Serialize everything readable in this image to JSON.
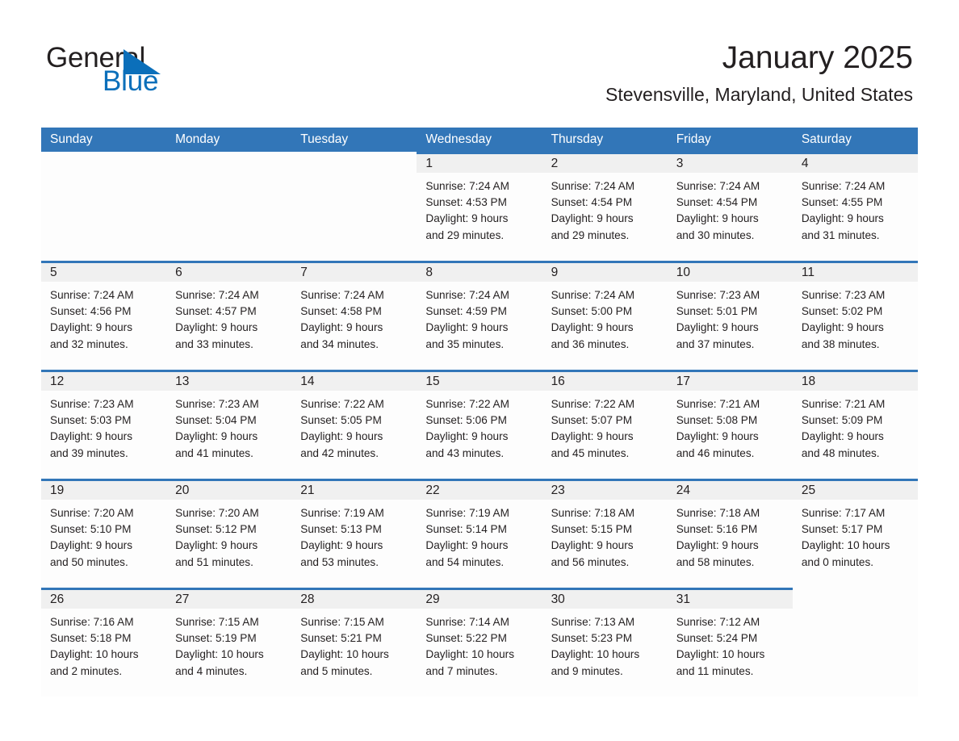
{
  "brand": {
    "name_part1": "General",
    "name_part2": "Blue",
    "accent_color": "#0b6fba",
    "logo_icon": "triangle-flag-icon"
  },
  "header": {
    "title": "January 2025",
    "subtitle": "Stevensville, Maryland, United States"
  },
  "theme": {
    "header_row_bg": "#3276b8",
    "day_band_bg": "#f0f0f0",
    "cell_bg": "#fdfdfd",
    "text_color": "#231f20"
  },
  "weekdays": [
    "Sunday",
    "Monday",
    "Tuesday",
    "Wednesday",
    "Thursday",
    "Friday",
    "Saturday"
  ],
  "weeks": [
    [
      {
        "blank": true
      },
      {
        "blank": true
      },
      {
        "blank": true
      },
      {
        "day": "1",
        "sunrise": "Sunrise: 7:24 AM",
        "sunset": "Sunset: 4:53 PM",
        "daylight_line1": "Daylight: 9 hours",
        "daylight_line2": "and 29 minutes."
      },
      {
        "day": "2",
        "sunrise": "Sunrise: 7:24 AM",
        "sunset": "Sunset: 4:54 PM",
        "daylight_line1": "Daylight: 9 hours",
        "daylight_line2": "and 29 minutes."
      },
      {
        "day": "3",
        "sunrise": "Sunrise: 7:24 AM",
        "sunset": "Sunset: 4:54 PM",
        "daylight_line1": "Daylight: 9 hours",
        "daylight_line2": "and 30 minutes."
      },
      {
        "day": "4",
        "sunrise": "Sunrise: 7:24 AM",
        "sunset": "Sunset: 4:55 PM",
        "daylight_line1": "Daylight: 9 hours",
        "daylight_line2": "and 31 minutes."
      }
    ],
    [
      {
        "day": "5",
        "sunrise": "Sunrise: 7:24 AM",
        "sunset": "Sunset: 4:56 PM",
        "daylight_line1": "Daylight: 9 hours",
        "daylight_line2": "and 32 minutes."
      },
      {
        "day": "6",
        "sunrise": "Sunrise: 7:24 AM",
        "sunset": "Sunset: 4:57 PM",
        "daylight_line1": "Daylight: 9 hours",
        "daylight_line2": "and 33 minutes."
      },
      {
        "day": "7",
        "sunrise": "Sunrise: 7:24 AM",
        "sunset": "Sunset: 4:58 PM",
        "daylight_line1": "Daylight: 9 hours",
        "daylight_line2": "and 34 minutes."
      },
      {
        "day": "8",
        "sunrise": "Sunrise: 7:24 AM",
        "sunset": "Sunset: 4:59 PM",
        "daylight_line1": "Daylight: 9 hours",
        "daylight_line2": "and 35 minutes."
      },
      {
        "day": "9",
        "sunrise": "Sunrise: 7:24 AM",
        "sunset": "Sunset: 5:00 PM",
        "daylight_line1": "Daylight: 9 hours",
        "daylight_line2": "and 36 minutes."
      },
      {
        "day": "10",
        "sunrise": "Sunrise: 7:23 AM",
        "sunset": "Sunset: 5:01 PM",
        "daylight_line1": "Daylight: 9 hours",
        "daylight_line2": "and 37 minutes."
      },
      {
        "day": "11",
        "sunrise": "Sunrise: 7:23 AM",
        "sunset": "Sunset: 5:02 PM",
        "daylight_line1": "Daylight: 9 hours",
        "daylight_line2": "and 38 minutes."
      }
    ],
    [
      {
        "day": "12",
        "sunrise": "Sunrise: 7:23 AM",
        "sunset": "Sunset: 5:03 PM",
        "daylight_line1": "Daylight: 9 hours",
        "daylight_line2": "and 39 minutes."
      },
      {
        "day": "13",
        "sunrise": "Sunrise: 7:23 AM",
        "sunset": "Sunset: 5:04 PM",
        "daylight_line1": "Daylight: 9 hours",
        "daylight_line2": "and 41 minutes."
      },
      {
        "day": "14",
        "sunrise": "Sunrise: 7:22 AM",
        "sunset": "Sunset: 5:05 PM",
        "daylight_line1": "Daylight: 9 hours",
        "daylight_line2": "and 42 minutes."
      },
      {
        "day": "15",
        "sunrise": "Sunrise: 7:22 AM",
        "sunset": "Sunset: 5:06 PM",
        "daylight_line1": "Daylight: 9 hours",
        "daylight_line2": "and 43 minutes."
      },
      {
        "day": "16",
        "sunrise": "Sunrise: 7:22 AM",
        "sunset": "Sunset: 5:07 PM",
        "daylight_line1": "Daylight: 9 hours",
        "daylight_line2": "and 45 minutes."
      },
      {
        "day": "17",
        "sunrise": "Sunrise: 7:21 AM",
        "sunset": "Sunset: 5:08 PM",
        "daylight_line1": "Daylight: 9 hours",
        "daylight_line2": "and 46 minutes."
      },
      {
        "day": "18",
        "sunrise": "Sunrise: 7:21 AM",
        "sunset": "Sunset: 5:09 PM",
        "daylight_line1": "Daylight: 9 hours",
        "daylight_line2": "and 48 minutes."
      }
    ],
    [
      {
        "day": "19",
        "sunrise": "Sunrise: 7:20 AM",
        "sunset": "Sunset: 5:10 PM",
        "daylight_line1": "Daylight: 9 hours",
        "daylight_line2": "and 50 minutes."
      },
      {
        "day": "20",
        "sunrise": "Sunrise: 7:20 AM",
        "sunset": "Sunset: 5:12 PM",
        "daylight_line1": "Daylight: 9 hours",
        "daylight_line2": "and 51 minutes."
      },
      {
        "day": "21",
        "sunrise": "Sunrise: 7:19 AM",
        "sunset": "Sunset: 5:13 PM",
        "daylight_line1": "Daylight: 9 hours",
        "daylight_line2": "and 53 minutes."
      },
      {
        "day": "22",
        "sunrise": "Sunrise: 7:19 AM",
        "sunset": "Sunset: 5:14 PM",
        "daylight_line1": "Daylight: 9 hours",
        "daylight_line2": "and 54 minutes."
      },
      {
        "day": "23",
        "sunrise": "Sunrise: 7:18 AM",
        "sunset": "Sunset: 5:15 PM",
        "daylight_line1": "Daylight: 9 hours",
        "daylight_line2": "and 56 minutes."
      },
      {
        "day": "24",
        "sunrise": "Sunrise: 7:18 AM",
        "sunset": "Sunset: 5:16 PM",
        "daylight_line1": "Daylight: 9 hours",
        "daylight_line2": "and 58 minutes."
      },
      {
        "day": "25",
        "sunrise": "Sunrise: 7:17 AM",
        "sunset": "Sunset: 5:17 PM",
        "daylight_line1": "Daylight: 10 hours",
        "daylight_line2": "and 0 minutes."
      }
    ],
    [
      {
        "day": "26",
        "sunrise": "Sunrise: 7:16 AM",
        "sunset": "Sunset: 5:18 PM",
        "daylight_line1": "Daylight: 10 hours",
        "daylight_line2": "and 2 minutes."
      },
      {
        "day": "27",
        "sunrise": "Sunrise: 7:15 AM",
        "sunset": "Sunset: 5:19 PM",
        "daylight_line1": "Daylight: 10 hours",
        "daylight_line2": "and 4 minutes."
      },
      {
        "day": "28",
        "sunrise": "Sunrise: 7:15 AM",
        "sunset": "Sunset: 5:21 PM",
        "daylight_line1": "Daylight: 10 hours",
        "daylight_line2": "and 5 minutes."
      },
      {
        "day": "29",
        "sunrise": "Sunrise: 7:14 AM",
        "sunset": "Sunset: 5:22 PM",
        "daylight_line1": "Daylight: 10 hours",
        "daylight_line2": "and 7 minutes."
      },
      {
        "day": "30",
        "sunrise": "Sunrise: 7:13 AM",
        "sunset": "Sunset: 5:23 PM",
        "daylight_line1": "Daylight: 10 hours",
        "daylight_line2": "and 9 minutes."
      },
      {
        "day": "31",
        "sunrise": "Sunrise: 7:12 AM",
        "sunset": "Sunset: 5:24 PM",
        "daylight_line1": "Daylight: 10 hours",
        "daylight_line2": "and 11 minutes."
      },
      {
        "blank": true
      }
    ]
  ]
}
